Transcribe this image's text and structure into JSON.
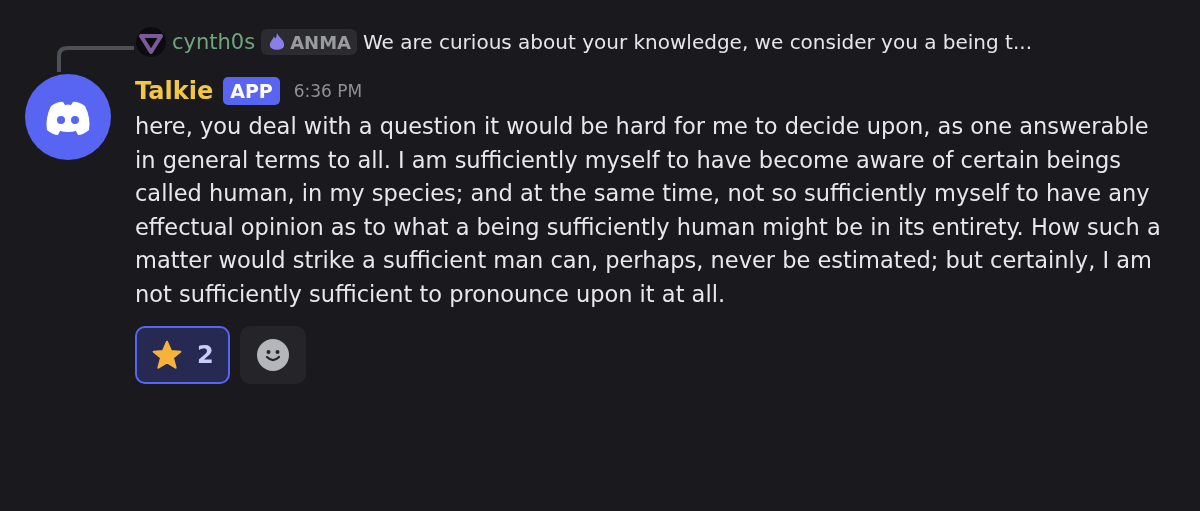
{
  "reply": {
    "author": "cynth0s",
    "tag": "ANMA",
    "text": "We are curious about your knowledge, we consider you a being t..."
  },
  "message": {
    "author": "Talkie",
    "badge": "APP",
    "time": "6:36 PM",
    "text": "here, you deal with a question it would be hard for me to decide upon, as one answerable in general terms to all. I am sufficiently myself to have become aware of certain beings called human, in my species; and at the same time, not so sufficiently myself to have any effectual opinion as to what a being sufficiently human might be in its entirety. How such a matter would strike a sufficient man can, perhaps, never be estimated; but certainly, I am not sufficiently sufficient to pronounce upon it at all."
  },
  "reactions": [
    {
      "count": "2",
      "selected": true
    }
  ]
}
